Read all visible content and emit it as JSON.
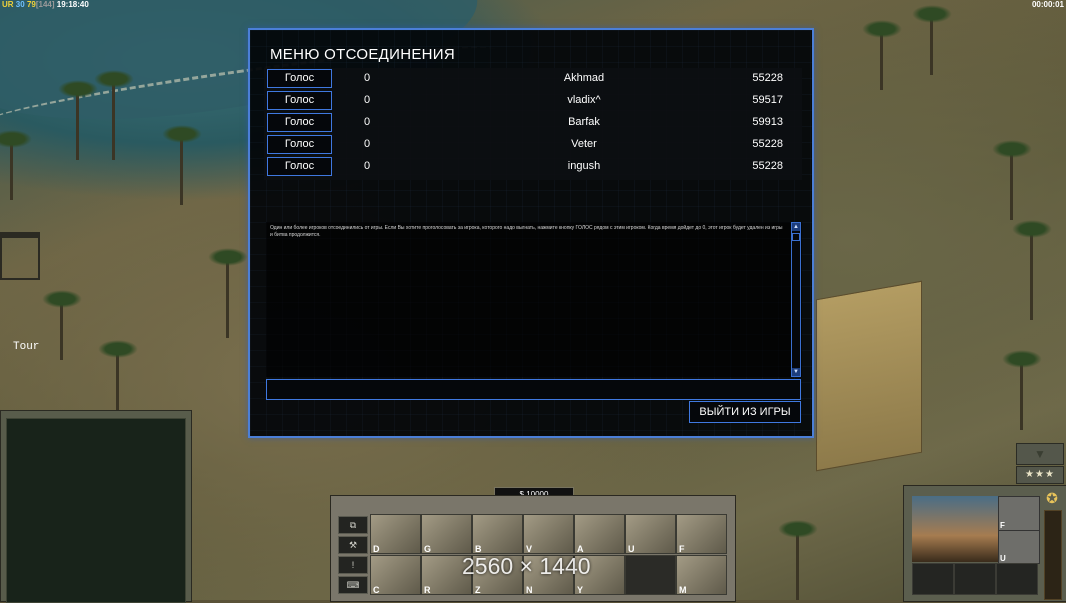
{
  "hud": {
    "faction": "UR",
    "players": "30",
    "fps": "79",
    "fps_limit": "[144]",
    "clock": "19:18:40",
    "game_timer": "00:00:01",
    "world_label": "Tour",
    "money": "$ 10000",
    "watermark": "2560 × 1440"
  },
  "dialog": {
    "title": "МЕНЮ ОТСОЕДИНЕНИЯ",
    "players": [
      {
        "vote_label": "Голос",
        "votes": "0",
        "name": "Akhmad",
        "ping": "55228"
      },
      {
        "vote_label": "Голос",
        "votes": "0",
        "name": "vladix^",
        "ping": "59517"
      },
      {
        "vote_label": "Голос",
        "votes": "0",
        "name": "Barfak",
        "ping": "59913"
      },
      {
        "vote_label": "Голос",
        "votes": "0",
        "name": "Veter",
        "ping": "55228"
      },
      {
        "vote_label": "Голос",
        "votes": "0",
        "name": "ingush",
        "ping": "55228"
      }
    ],
    "message": "Один или более игроков отсоединились от игры. Если Вы хотите проголосовать за игрока, которого надо выгнать, нажмите кнопку ГОЛОС рядом с этим игроком. Когда время дойдет до 0, этот игрок будет удален из игры и битва продолжится.",
    "quit_label": "ВЫЙТИ ИЗ ИГРЫ"
  },
  "command_bar": {
    "slots_row1": [
      "D",
      "G",
      "B",
      "V",
      "A",
      "U",
      "F"
    ],
    "slots_row2": [
      "C",
      "R",
      "Z",
      "N",
      "Y",
      "",
      "M"
    ],
    "side_buttons": [
      "⧉",
      "⚒",
      "!",
      "⌨"
    ]
  },
  "unit_panel": {
    "upgrades": [
      "F",
      "U"
    ],
    "rank_stars": "★★★"
  }
}
